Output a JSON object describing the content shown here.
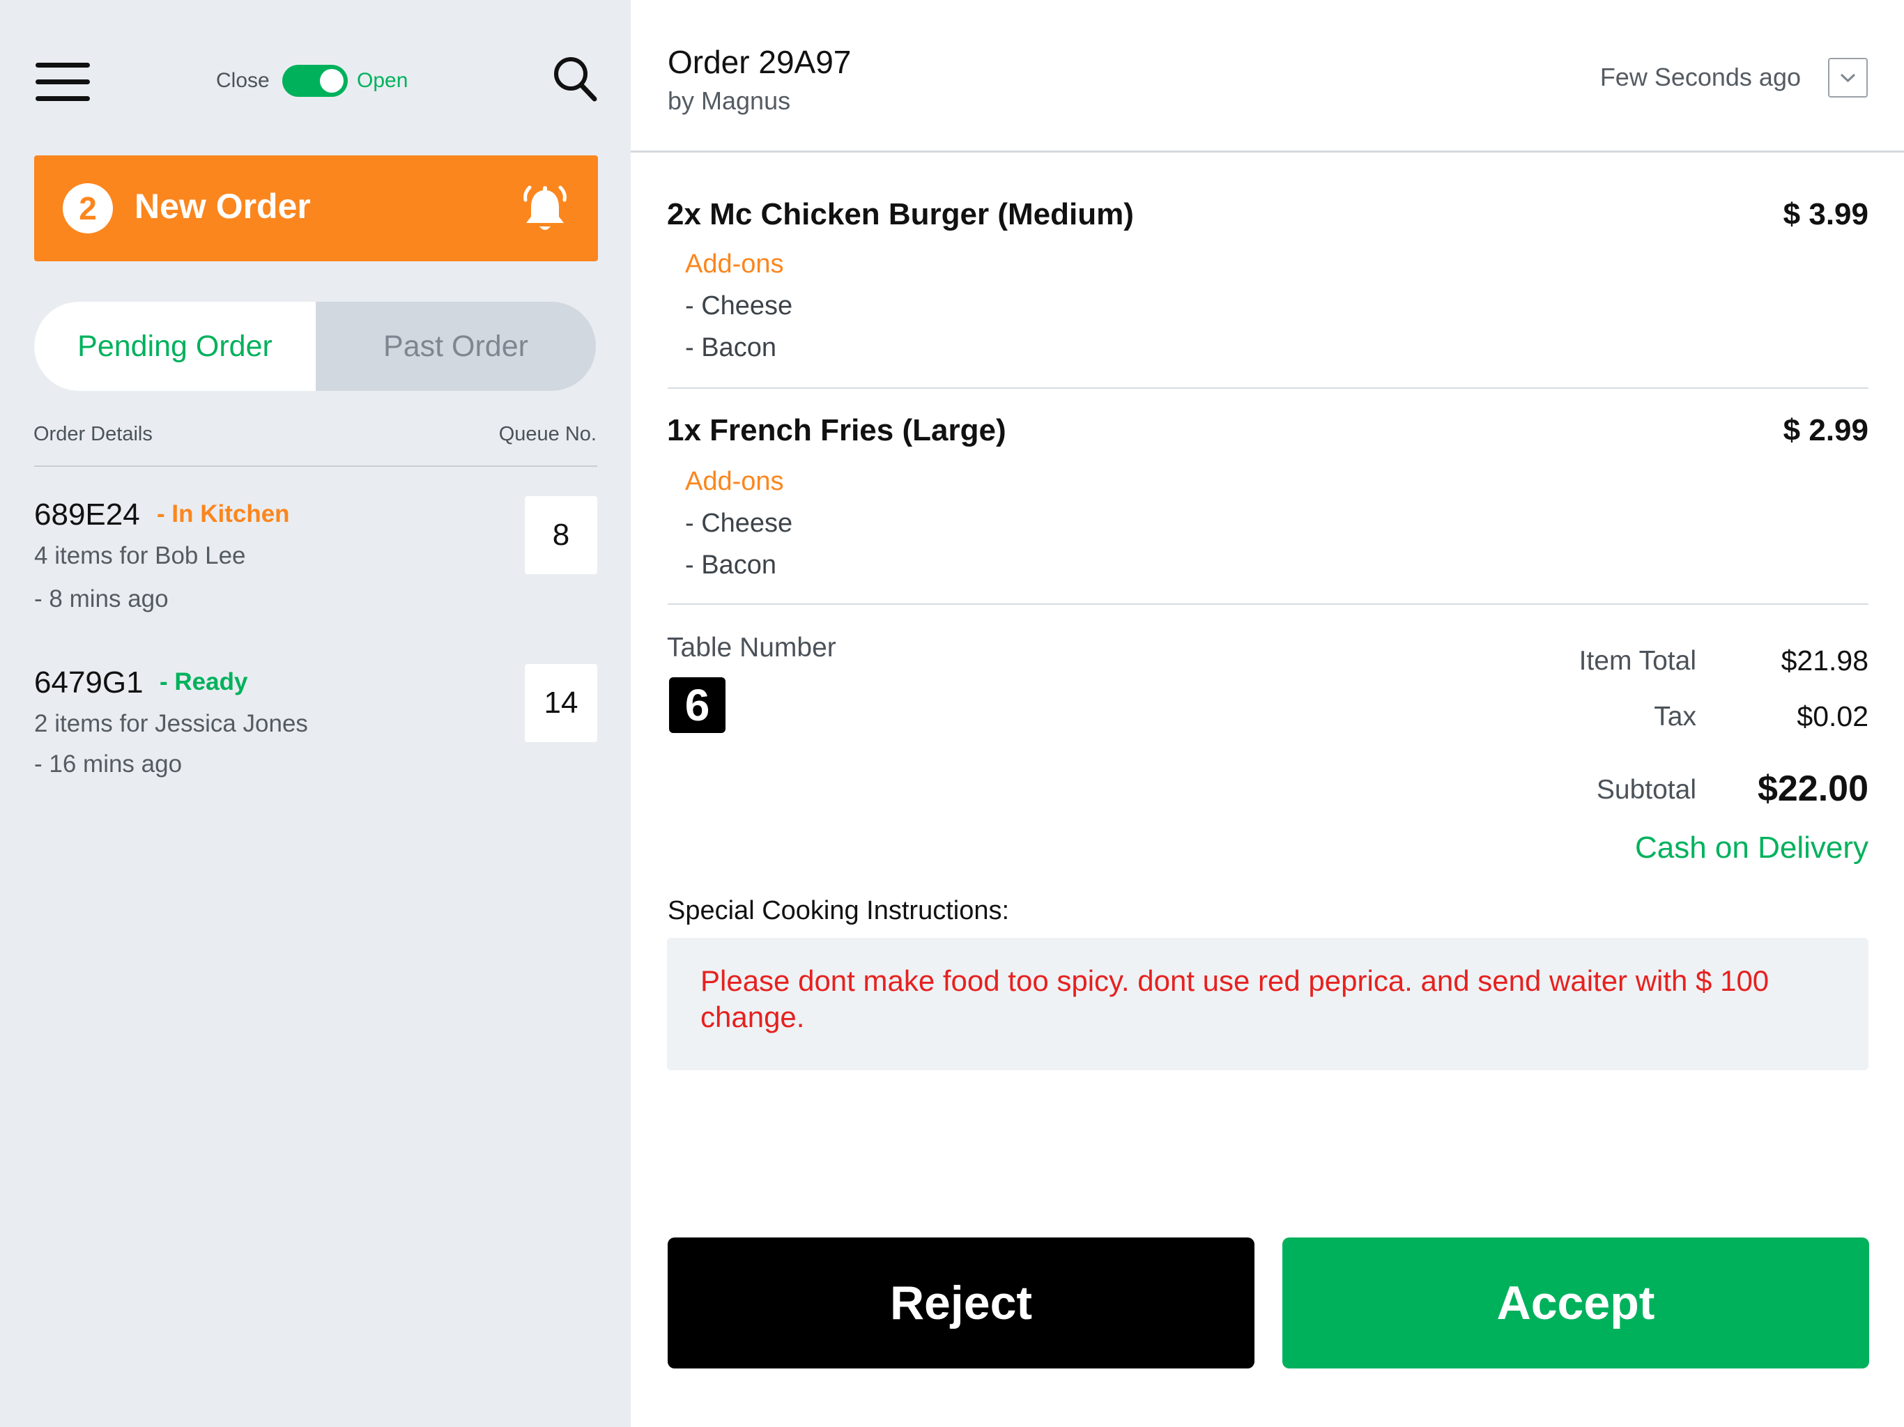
{
  "header": {
    "toggle_close_label": "Close",
    "toggle_open_label": "Open",
    "store_open": true
  },
  "new_order": {
    "count": "2",
    "label": "New Order"
  },
  "tabs": {
    "pending": "Pending Order",
    "past": "Past Order"
  },
  "list_headers": {
    "details": "Order Details",
    "queue": "Queue No."
  },
  "orders": [
    {
      "id": "689E24",
      "status": "- In Kitchen",
      "status_color": "#fb861e",
      "description": "4 items for Bob Lee",
      "time": "- 8 mins ago",
      "queue": "8"
    },
    {
      "id": "6479G1",
      "status": "- Ready",
      "status_color": "#00b15c",
      "description": "2 items for Jessica Jones",
      "time": "- 16 mins ago",
      "queue": "14"
    }
  ],
  "detail": {
    "title": "Order 29A97",
    "by": "by Magnus",
    "time": "Few Seconds ago",
    "items": [
      {
        "title": "2x Mc Chicken Burger (Medium)",
        "price": "$ 3.99",
        "addons_label": "Add-ons",
        "addons": [
          "- Cheese",
          "- Bacon"
        ]
      },
      {
        "title": "1x French Fries (Large)",
        "price": "$ 2.99",
        "addons_label": "Add-ons",
        "addons": [
          "- Cheese",
          "- Bacon"
        ]
      }
    ],
    "table_label": "Table Number",
    "table_number": "6",
    "totals": {
      "item_total_label": "Item Total",
      "item_total": "$21.98",
      "tax_label": "Tax",
      "tax": "$0.02",
      "subtotal_label": "Subtotal",
      "subtotal": "$22.00"
    },
    "payment": "Cash on Delivery",
    "instructions_label": "Special Cooking Instructions:",
    "instructions": "Please dont make food too spicy. dont use red peprica. and send waiter with $ 100 change.",
    "reject": "Reject",
    "accept": "Accept"
  },
  "colors": {
    "accent_orange": "#fb861e",
    "accent_green": "#00b15c",
    "instruction_red": "#e6211f"
  },
  "icons": [
    "menu-icon",
    "search-icon",
    "bell-icon",
    "chevron-down-icon"
  ]
}
